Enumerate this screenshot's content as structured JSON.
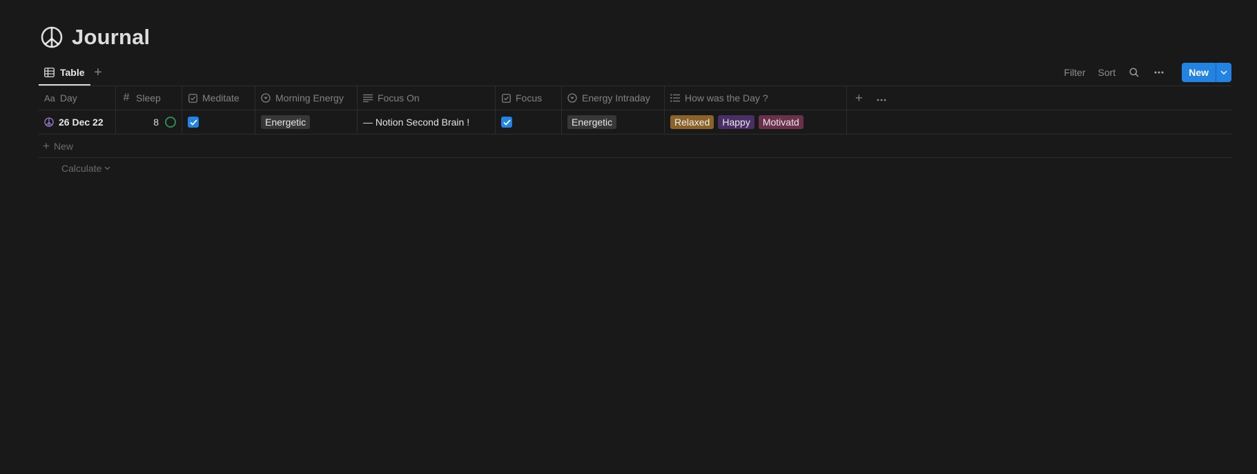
{
  "page": {
    "title": "Journal",
    "icon": "peace-icon"
  },
  "view": {
    "tab_label": "Table",
    "add_view_icon": "plus-icon"
  },
  "toolbar": {
    "filter_label": "Filter",
    "sort_label": "Sort",
    "new_label": "New"
  },
  "columns": [
    {
      "key": "day",
      "label": "Day",
      "icon": "title-aa-icon",
      "icon_text": "Aa"
    },
    {
      "key": "sleep",
      "label": "Sleep",
      "icon": "number-icon",
      "icon_text": "#"
    },
    {
      "key": "meditate",
      "label": "Meditate",
      "icon": "checkbox-icon"
    },
    {
      "key": "morning_energy",
      "label": "Morning Energy",
      "icon": "select-icon"
    },
    {
      "key": "focus_on",
      "label": "Focus On",
      "icon": "text-icon"
    },
    {
      "key": "focus",
      "label": "Focus",
      "icon": "checkbox-icon"
    },
    {
      "key": "energy_intraday",
      "label": "Energy Intraday",
      "icon": "select-icon"
    },
    {
      "key": "how_was_day",
      "label": "How was the Day ?",
      "icon": "list-icon"
    }
  ],
  "rows": [
    {
      "day": "26 Dec 22",
      "sleep": "8",
      "meditate": true,
      "morning_energy": "Energetic",
      "focus_on": "— Notion Second Brain !",
      "focus": true,
      "energy_intraday": "Energetic",
      "how_was_day": [
        {
          "label": "Relaxed",
          "color": "#89632a"
        },
        {
          "label": "Happy",
          "color": "#492f64"
        },
        {
          "label": "Motivatd",
          "color": "#69314c"
        }
      ]
    }
  ],
  "table": {
    "new_row_label": "New",
    "calculate_label": "Calculate"
  },
  "colors": {
    "background": "#191919",
    "accent": "#2383e2",
    "sleep_ring": "#2e8b57",
    "tag_gray": "#373737"
  }
}
